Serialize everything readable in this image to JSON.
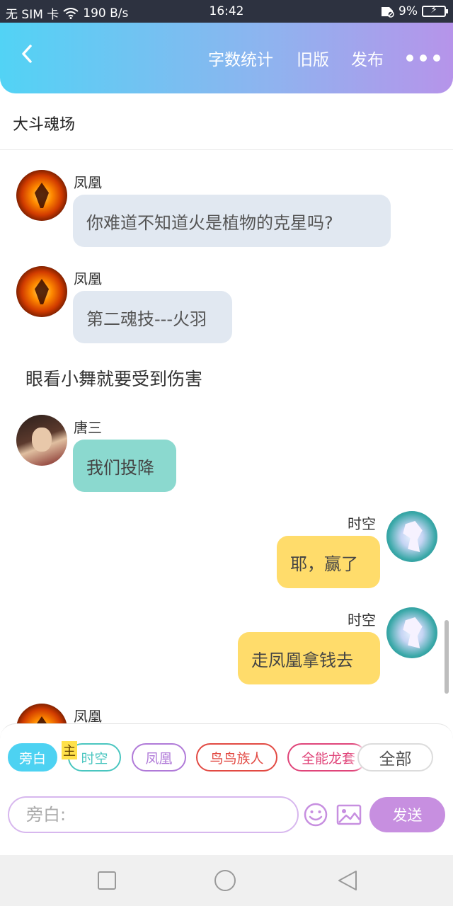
{
  "status_bar": {
    "carrier": "无 SIM 卡",
    "speed": "190 B/s",
    "time": "16:42",
    "battery": "9%"
  },
  "header": {
    "word_count": "字数统计",
    "old_version": "旧版",
    "publish": "发布"
  },
  "doc_title": "大斗魂场",
  "messages": [
    {
      "speaker": "凤凰",
      "text": "你难道不知道火是植物的克星吗?"
    },
    {
      "speaker": "凤凰",
      "text": "第二魂技---火羽"
    },
    {
      "narration": "眼看小舞就要受到伤害"
    },
    {
      "speaker": "唐三",
      "text": "我们投降"
    },
    {
      "speaker": "时空",
      "text": "耶，赢了"
    },
    {
      "speaker": "时空",
      "text": "走凤凰拿钱去"
    },
    {
      "speaker": "凤凰"
    }
  ],
  "compose": {
    "chips": [
      "旁白",
      "时空",
      "凤凰",
      "鸟鸟族人",
      "全能龙套"
    ],
    "main_badge": "主",
    "all_label": "全部",
    "input_placeholder": "旁白:",
    "send_label": "发送"
  },
  "colors": {
    "header_gradient_start": "#52d3f5",
    "header_gradient_end": "#b694ea",
    "bubble_gray": "#e1e8f1",
    "bubble_teal": "#8bd9cf",
    "bubble_yellow": "#ffdc6b",
    "send_button": "#c78fe0"
  }
}
